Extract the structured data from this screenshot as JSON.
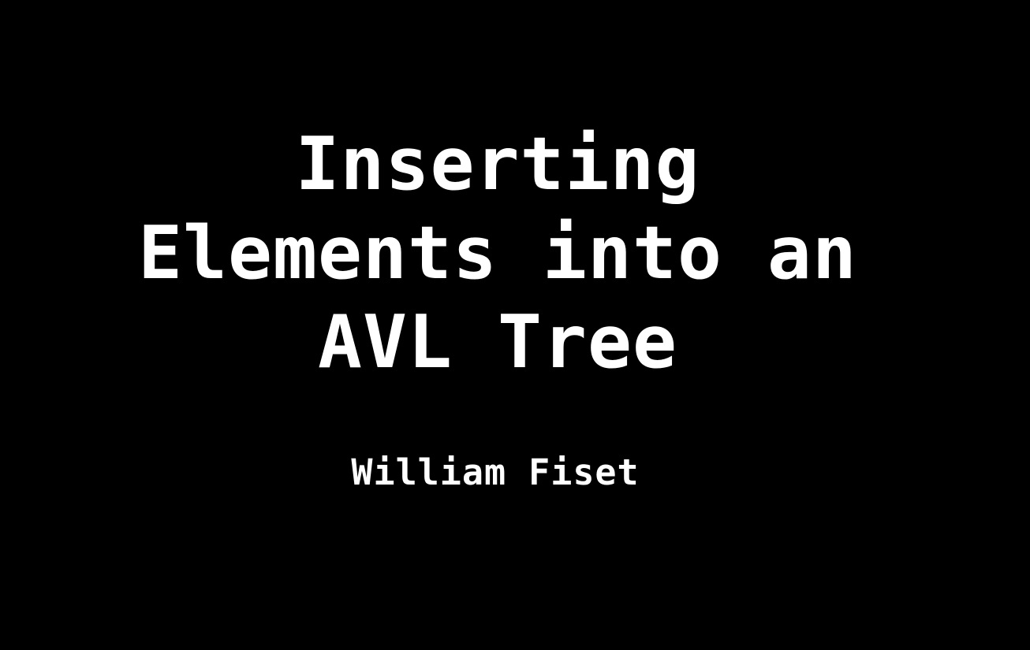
{
  "slide": {
    "title_lines": [
      "Inserting",
      "Elements into an",
      "AVL Tree"
    ],
    "author": "William Fiset"
  },
  "colors": {
    "background": "#000000",
    "text": "#ffffff"
  }
}
